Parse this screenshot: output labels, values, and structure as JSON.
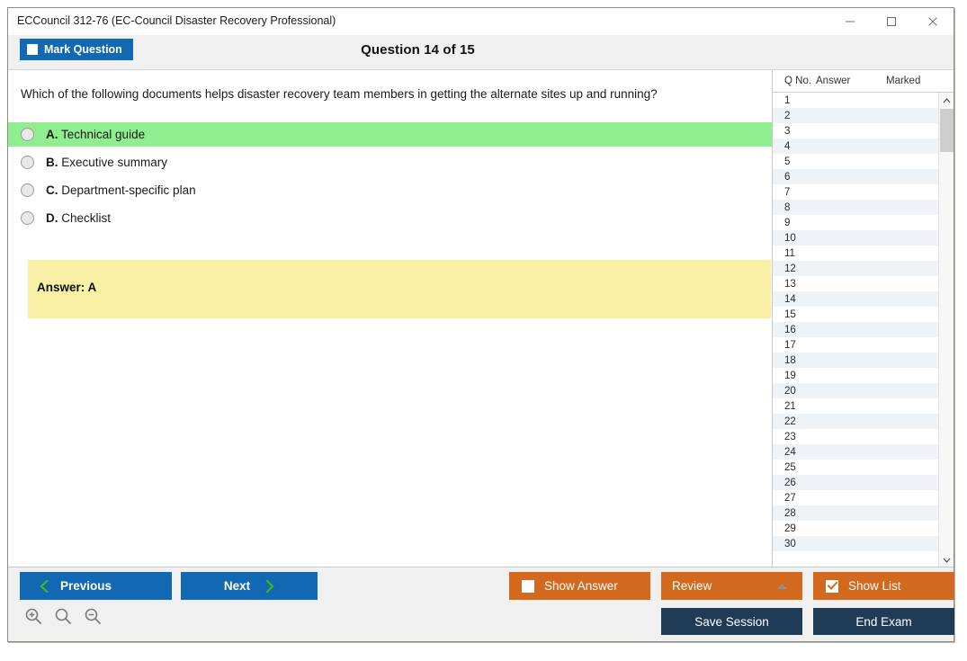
{
  "window": {
    "title": "ECCouncil 312-76 (EC-Council Disaster Recovery Professional)",
    "controls": {
      "minimize": "minimize-icon",
      "maximize": "maximize-icon",
      "close": "close-icon"
    }
  },
  "toolbar": {
    "mark_question_label": "Mark Question",
    "mark_question_checked": false,
    "question_counter": "Question 14 of 15"
  },
  "question": {
    "text": "Which of the following documents helps disaster recovery team members in getting the alternate sites up and running?",
    "options": [
      {
        "letter": "A.",
        "text": "Technical guide",
        "correct": true
      },
      {
        "letter": "B.",
        "text": "Executive summary",
        "correct": false
      },
      {
        "letter": "C.",
        "text": "Department-specific plan",
        "correct": false
      },
      {
        "letter": "D.",
        "text": "Checklist",
        "correct": false
      }
    ],
    "answer_label": "Answer: A"
  },
  "list_panel": {
    "headers": {
      "qno": "Q No.",
      "answer": "Answer",
      "marked": "Marked"
    },
    "rows": [
      {
        "qno": "1",
        "answer": "",
        "marked": ""
      },
      {
        "qno": "2",
        "answer": "",
        "marked": ""
      },
      {
        "qno": "3",
        "answer": "",
        "marked": ""
      },
      {
        "qno": "4",
        "answer": "",
        "marked": ""
      },
      {
        "qno": "5",
        "answer": "",
        "marked": ""
      },
      {
        "qno": "6",
        "answer": "",
        "marked": ""
      },
      {
        "qno": "7",
        "answer": "",
        "marked": ""
      },
      {
        "qno": "8",
        "answer": "",
        "marked": ""
      },
      {
        "qno": "9",
        "answer": "",
        "marked": ""
      },
      {
        "qno": "10",
        "answer": "",
        "marked": ""
      },
      {
        "qno": "11",
        "answer": "",
        "marked": ""
      },
      {
        "qno": "12",
        "answer": "",
        "marked": ""
      },
      {
        "qno": "13",
        "answer": "",
        "marked": ""
      },
      {
        "qno": "14",
        "answer": "",
        "marked": ""
      },
      {
        "qno": "15",
        "answer": "",
        "marked": ""
      },
      {
        "qno": "16",
        "answer": "",
        "marked": ""
      },
      {
        "qno": "17",
        "answer": "",
        "marked": ""
      },
      {
        "qno": "18",
        "answer": "",
        "marked": ""
      },
      {
        "qno": "19",
        "answer": "",
        "marked": ""
      },
      {
        "qno": "20",
        "answer": "",
        "marked": ""
      },
      {
        "qno": "21",
        "answer": "",
        "marked": ""
      },
      {
        "qno": "22",
        "answer": "",
        "marked": ""
      },
      {
        "qno": "23",
        "answer": "",
        "marked": ""
      },
      {
        "qno": "24",
        "answer": "",
        "marked": ""
      },
      {
        "qno": "25",
        "answer": "",
        "marked": ""
      },
      {
        "qno": "26",
        "answer": "",
        "marked": ""
      },
      {
        "qno": "27",
        "answer": "",
        "marked": ""
      },
      {
        "qno": "28",
        "answer": "",
        "marked": ""
      },
      {
        "qno": "29",
        "answer": "",
        "marked": ""
      },
      {
        "qno": "30",
        "answer": "",
        "marked": ""
      }
    ],
    "scrollbar": {
      "up": "chevron-up-icon",
      "down": "chevron-down-icon"
    }
  },
  "bottom_bar": {
    "previous_label": "Previous",
    "next_label": "Next",
    "show_answer_label": "Show Answer",
    "show_answer_checked": false,
    "review_label": "Review",
    "show_list_label": "Show List",
    "show_list_checked": true,
    "save_session_label": "Save Session",
    "end_exam_label": "End Exam",
    "zoom_in": "zoom-in-icon",
    "zoom_reset": "zoom-reset-icon",
    "zoom_out": "zoom-out-icon"
  },
  "colors": {
    "primary_blue": "#1268b3",
    "orange": "#d2691e",
    "navy": "#1f3b55",
    "correct_green": "#90ee90",
    "answer_yellow": "#faf0a5",
    "chevron_green": "#3cb521"
  }
}
